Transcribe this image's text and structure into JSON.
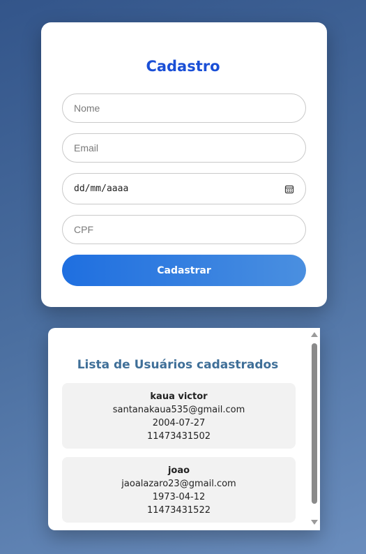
{
  "form": {
    "title": "Cadastro",
    "nome_placeholder": "Nome",
    "email_placeholder": "Email",
    "date_placeholder": "dd/mm/aaaa",
    "cpf_placeholder": "CPF",
    "submit_label": "Cadastrar"
  },
  "list": {
    "title": "Lista de Usuários cadastrados",
    "users": [
      {
        "name": "kaua victor",
        "email": "santanakaua535@gmail.com",
        "birth": "2004-07-27",
        "phone": "11473431502"
      },
      {
        "name": "joao",
        "email": "jaoalazaro23@gmail.com",
        "birth": "1973-04-12",
        "phone": "11473431522"
      }
    ]
  },
  "icons": {
    "calendar": "calendar-icon",
    "scroll_up": "scroll-up-arrow-icon",
    "scroll_down": "scroll-down-arrow-icon"
  },
  "colors": {
    "title_blue": "#1a4fd6",
    "list_title": "#3f6f98",
    "button_start": "#1f6fe0",
    "button_end": "#4a8fe0"
  }
}
